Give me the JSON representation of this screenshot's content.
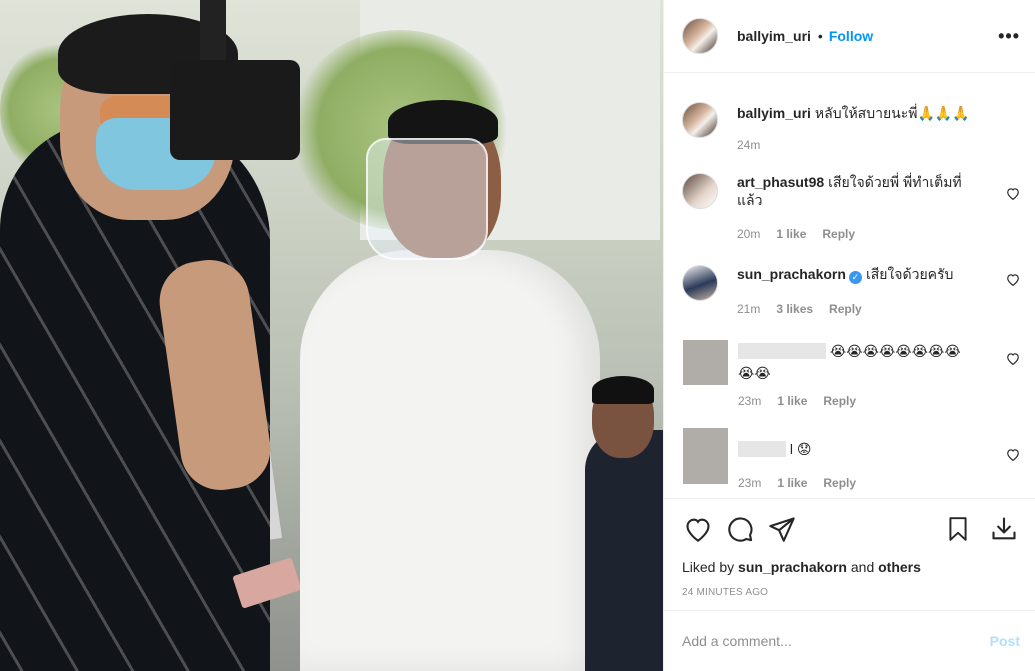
{
  "post": {
    "image_alt": "Photo of two men at an outdoor event, one holding a microphone, one wearing a face shield"
  },
  "header": {
    "username": "ballyim_uri",
    "separator": "•",
    "follow_label": "Follow",
    "more_label": "•••"
  },
  "caption": {
    "username": "ballyim_uri",
    "text": "หลับให้สบายนะพี่🙏🙏🙏",
    "time": "24m"
  },
  "comments": [
    {
      "username": "art_phasut98",
      "text": "เสียใจด้วยพี่ พี่ทำเต็มที่แล้ว",
      "time": "20m",
      "likes": "1 like",
      "reply": "Reply"
    },
    {
      "username": "sun_prachakorn",
      "verified": true,
      "text": "เสียใจด้วยครับ",
      "time": "21m",
      "likes": "3 likes",
      "reply": "Reply"
    },
    {
      "username": "",
      "text": "😭😭😭😭😭😭😭😭😭😭",
      "time": "23m",
      "likes": "1 like",
      "reply": "Reply"
    },
    {
      "username": "",
      "text": "l 😟",
      "time": "23m",
      "likes": "1 like",
      "reply": "Reply"
    }
  ],
  "actions": {
    "liked_by_prefix": "Liked by ",
    "liked_by_user": "sun_prachakorn",
    "liked_by_and": " and ",
    "liked_by_others": "others",
    "time_ago": "24 MINUTES AGO"
  },
  "add_comment": {
    "placeholder": "Add a comment...",
    "post_label": "Post"
  },
  "colors": {
    "link_blue": "#0095f6",
    "post_disabled": "#b2dffc",
    "muted": "#8e8e8e",
    "text": "#262626",
    "border": "#efefef"
  },
  "icons": [
    "heart-icon",
    "comment-icon",
    "share-icon",
    "bookmark-icon",
    "download-icon",
    "more-icon",
    "verified-icon"
  ]
}
